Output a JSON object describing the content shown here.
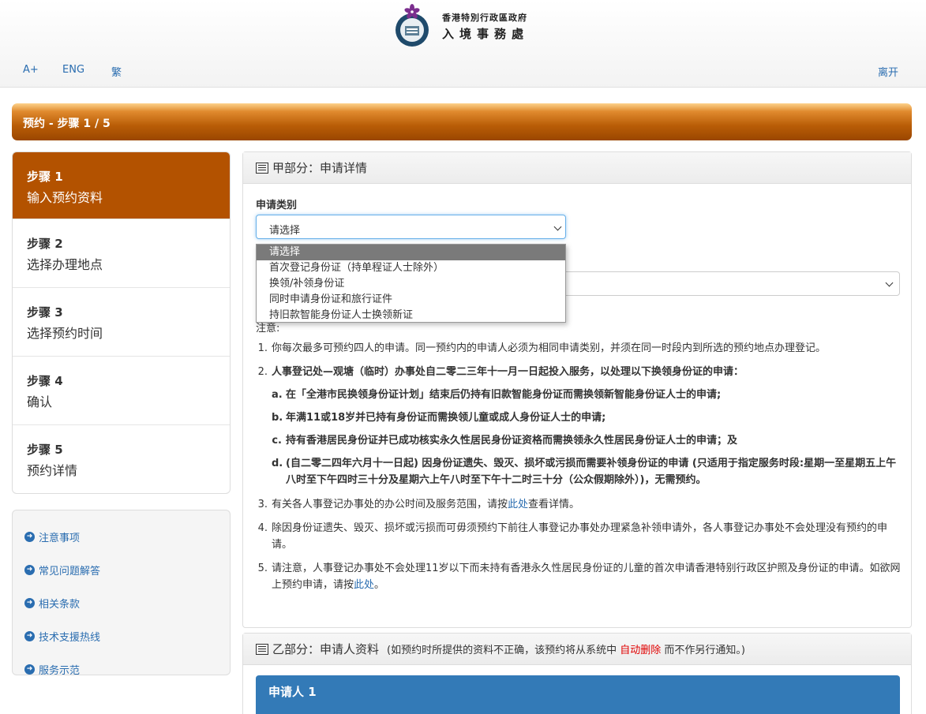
{
  "header": {
    "org_line1": "香港特別行政區政府",
    "org_line2": "入境事務處",
    "links": {
      "font": "A+",
      "eng": "ENG",
      "trad": "繁",
      "leave": "离开"
    }
  },
  "banner": {
    "title": "预约 - 步骤 1 / 5"
  },
  "steps": [
    {
      "num": "步骤 1",
      "label": "输入预约资料"
    },
    {
      "num": "步骤 2",
      "label": "选择办理地点"
    },
    {
      "num": "步骤 3",
      "label": "选择预约时间"
    },
    {
      "num": "步骤 4",
      "label": "确认"
    },
    {
      "num": "步骤 5",
      "label": "预约详情"
    }
  ],
  "links": [
    "注意事项",
    "常见问题解答",
    "相关条款",
    "技术支援热线",
    "服务示范"
  ],
  "partA": {
    "title": "甲部分：申请详情",
    "field_label": "申请类别",
    "select_value": "请选择",
    "options": [
      "请选择",
      "首次登记身份证（持单程证人士除外）",
      "换领/补领身份证",
      "同时申请身份证和旅行证件",
      "持旧款智能身份证人士换领新证"
    ],
    "notes_title": "注意:",
    "notes": {
      "n1": "你每次最多可预约四人的申请。同一预约内的申请人必须为相同申请类别，并须在同一时段内到所选的预约地点办理登记。",
      "n2": "人事登记处—观塘（临时）办事处自二零二三年十一月一日起投入服务，以处理以下换领身份证的申请：",
      "n2a": "在「全港市民换领身份证计划」结束后仍持有旧款智能身份证而需换领新智能身份证人士的申请;",
      "n2b": "年满11或18岁并已持有身份证而需换领儿童或成人身份证人士的申请;",
      "n2c": "持有香港居民身份证并已成功核实永久性居民身份证资格而需换领永久性居民身份证人士的申请；及",
      "n2d": "(自二零二四年六月十一日起) 因身份证遗失、毁灭、损坏或污损而需要补领身份证的申请 (只适用于指定服务时段:星期一至星期五上午八时至下午四时三十分及星期六上午八时至下午十二时三十分（公众假期除外）)，无需预约。",
      "n3_pre": "有关各人事登记办事处的办公时间及服务范围，请按",
      "n3_link": "此处",
      "n3_post": "查看详情。",
      "n4": "除因身份证遗失、毁灭、损坏或污损而可毋须预约下前往人事登记办事处办理紧急补领申请外，各人事登记办事处不会处理没有预约的申请。",
      "n5_pre": "请注意，人事登记办事处不会处理11岁以下而未持有香港永久性居民身份证的儿童的首次申请香港特别行政区护照及身份证的申请。如欲网上预约申请，请按",
      "n5_link": "此处",
      "n5_post": "。"
    }
  },
  "partB": {
    "title": "乙部分：申请人资料",
    "note_pre": "(如预约时所提供的资料不正确，该预约将从系统中",
    "note_red": "自动删除",
    "note_post": "而不作另行通知。)",
    "applicant": "申请人 1"
  },
  "colors": {
    "accent": "#b35200",
    "link": "#2a6db0",
    "applicant_bar": "#337ab7"
  }
}
